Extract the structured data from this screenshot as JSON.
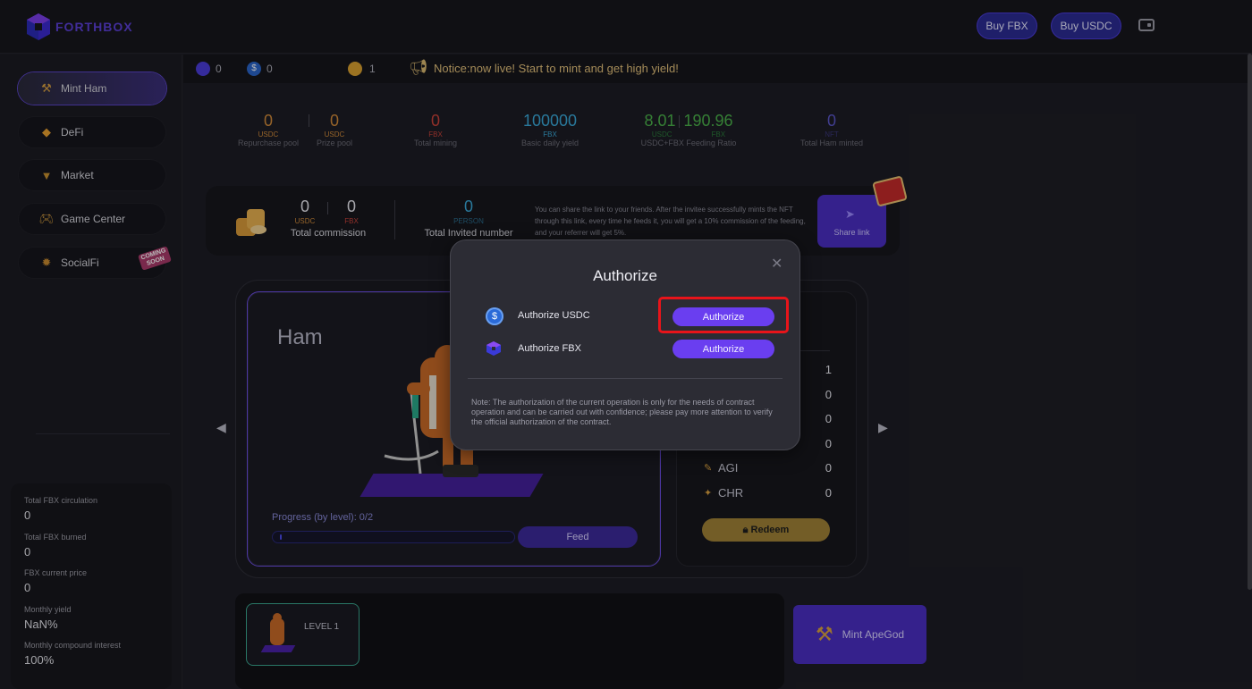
{
  "header": {
    "logo_text": "FORTHBOX",
    "buy_fbx": "Buy FBX",
    "buy_usdc": "Buy USDC"
  },
  "sidebar": {
    "items": [
      {
        "label": "Mint Ham",
        "icon": "hammer-icon"
      },
      {
        "label": "DeFi",
        "icon": "diamond-icon"
      },
      {
        "label": "Market",
        "icon": "market-icon"
      },
      {
        "label": "Game Center",
        "icon": "gamepad-icon"
      },
      {
        "label": "SocialFi",
        "icon": "socialfi-icon"
      }
    ],
    "coming_soon": "COMING SOON",
    "stats": [
      {
        "label": "Total FBX circulation",
        "value": "0"
      },
      {
        "label": "Total FBX burned",
        "value": "0"
      },
      {
        "label": "FBX current price",
        "value": "0"
      },
      {
        "label": "Monthly yield",
        "value": "NaN%"
      },
      {
        "label": "Monthly compound interest",
        "value": "100%"
      }
    ]
  },
  "notice_bar": {
    "fbx_balance": "0",
    "usdc_balance": "0",
    "ham_count": "1",
    "notice": "Notice:now live! Start to mint and get high yield!"
  },
  "top_stats": {
    "repurchase_pool": {
      "value": "0",
      "unit": "USDC",
      "label": "Repurchase pool"
    },
    "prize_pool": {
      "value": "0",
      "unit": "USDC",
      "label": "Prize pool"
    },
    "total_mining": {
      "value": "0",
      "unit": "FBX",
      "label": "Total mining"
    },
    "basic_daily_yield": {
      "value": "100000",
      "unit": "FBX",
      "label": "Basic daily yield"
    },
    "feeding_ratio": {
      "usdc": "8.01",
      "fbx": "190.96",
      "unit_usdc": "USDC",
      "unit_fbx": "FBX",
      "label": "USDC+FBX Feeding Ratio"
    },
    "ham_minted": {
      "value": "0",
      "unit": "NFT",
      "label": "Total Ham minted"
    }
  },
  "commission": {
    "usdc_value": "0",
    "usdc_unit": "USDC",
    "fbx_value": "0",
    "fbx_unit": "FBX",
    "total_label": "Total commission",
    "invited_value": "0",
    "invited_unit": "PERSON",
    "invited_label": "Total Invited number",
    "description": "You can share the link to your friends. After the invitee successfully mints the NFT through this link, every time he feeds it, you will get a 10% commission of the feeding, and your referrer will get 5%.",
    "share_label": "Share link"
  },
  "ham_card": {
    "title": "Ham",
    "progress_label": "Progress (by level): 0/2",
    "progress_fraction": 0,
    "feed_label": "Feed"
  },
  "attributes": {
    "values": [
      "1",
      "0",
      "0",
      "0"
    ],
    "agi_label": "AGI",
    "agi_value": "0",
    "chr_label": "CHR",
    "chr_value": "0",
    "redeem_label": "Redeem"
  },
  "bottom": {
    "level_label": "LEVEL 1",
    "mint_apegod": "Mint ApeGod"
  },
  "modal": {
    "title": "Authorize",
    "rows": [
      {
        "label": "Authorize USDC",
        "button": "Authorize",
        "icon": "usdc-icon"
      },
      {
        "label": "Authorize FBX",
        "button": "Authorize",
        "icon": "fbx-icon"
      }
    ],
    "note": "Note: The authorization of the current operation is only for the needs of contract operation and can be carried out with confidence; please pay more attention to verify the official authorization of the contract."
  },
  "colors": {
    "accent": "#6a3ef0",
    "highlight": "#e8141a",
    "usdc_stat": "#d08a3a",
    "fbx_stat": "#c8423a",
    "yield_stat": "#3aa8d8",
    "ratio_stat": "#4ab04a",
    "nft_stat": "#5a56c8"
  }
}
